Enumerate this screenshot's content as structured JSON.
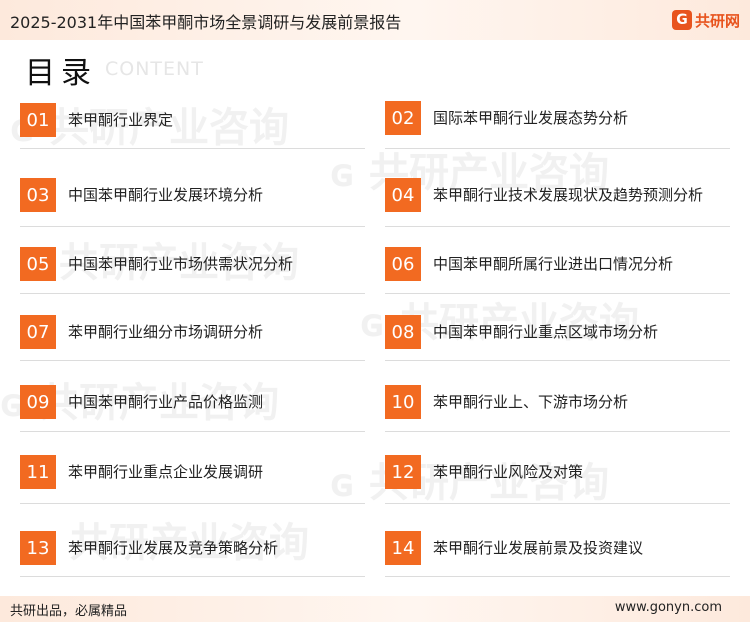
{
  "header": {
    "title": "2025-2031年中国苯甲酮市场全景调研与发展前景报告",
    "brand_mark": "G",
    "brand_name": "共研网"
  },
  "toc": {
    "title": "目录",
    "subtitle": "CONTENT"
  },
  "items": [
    {
      "num": "01",
      "label": "苯甲酮行业界定"
    },
    {
      "num": "02",
      "label": "国际苯甲酮行业发展态势分析"
    },
    {
      "num": "03",
      "label": "中国苯甲酮行业发展环境分析"
    },
    {
      "num": "04",
      "label": "苯甲酮行业技术发展现状及趋势预测分析"
    },
    {
      "num": "05",
      "label": "中国苯甲酮行业市场供需状况分析"
    },
    {
      "num": "06",
      "label": "中国苯甲酮所属行业进出口情况分析"
    },
    {
      "num": "07",
      "label": "苯甲酮行业细分市场调研分析"
    },
    {
      "num": "08",
      "label": "中国苯甲酮行业重点区域市场分析"
    },
    {
      "num": "09",
      "label": "中国苯甲酮行业产品价格监测"
    },
    {
      "num": "10",
      "label": "苯甲酮行业上、下游市场分析"
    },
    {
      "num": "11",
      "label": "苯甲酮行业重点企业发展调研"
    },
    {
      "num": "12",
      "label": "苯甲酮行业风险及对策"
    },
    {
      "num": "13",
      "label": "苯甲酮行业发展及竞争策略分析"
    },
    {
      "num": "14",
      "label": "苯甲酮行业发展前景及投资建议"
    }
  ],
  "footer": {
    "left": "共研出品，必属精品",
    "right": "www.gonyn.com"
  },
  "colors": {
    "accent": "#f26a21",
    "brand": "#e8541e"
  }
}
